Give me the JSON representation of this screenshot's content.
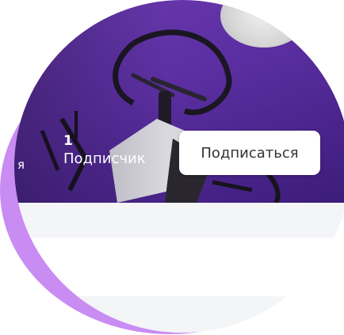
{
  "profile_banner": {
    "partial_label": "я",
    "stat_value": "1",
    "stat_label": "Подписчик"
  },
  "actions": {
    "subscribe_label": "Подписаться"
  },
  "colors": {
    "accent_ring": "#c98cf2",
    "banner_purple": "#5a2ea0",
    "button_bg": "#ffffff",
    "content_bg": "#f4f5f7"
  }
}
